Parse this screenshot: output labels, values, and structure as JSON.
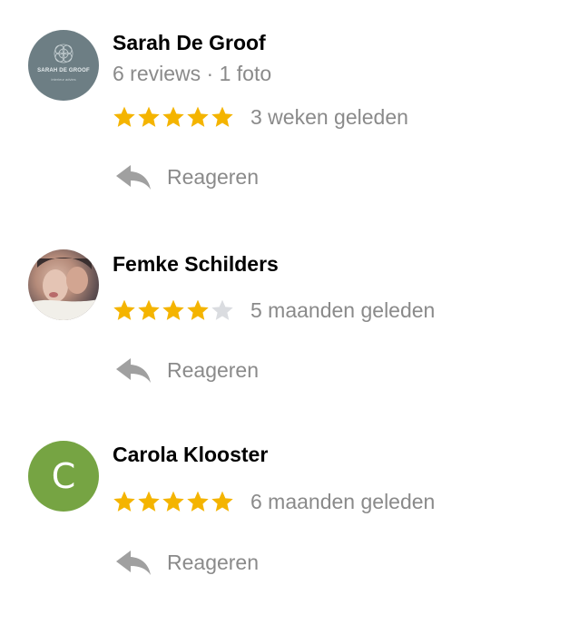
{
  "reviews": [
    {
      "name": "Sarah De Groof",
      "meta": "6 reviews · 1 foto",
      "rating": 5,
      "date": "3 weken geleden",
      "reply_label": "Reageren",
      "avatar": {
        "type": "logo",
        "logo_text": "SARAH DE GROOF",
        "logo_sub": "interieur advies"
      }
    },
    {
      "name": "Femke Schilders",
      "rating": 4,
      "date": "5 maanden geleden",
      "reply_label": "Reageren",
      "avatar": {
        "type": "photo"
      }
    },
    {
      "name": "Carola Klooster",
      "rating": 5,
      "date": "6 maanden geleden",
      "reply_label": "Reageren",
      "avatar": {
        "type": "letter",
        "letter": "C"
      }
    }
  ],
  "colors": {
    "star_filled": "#f4b400",
    "star_empty": "#dadce0",
    "avatar_letter_bg": "#76a443",
    "muted_text": "#8a8a8a"
  }
}
